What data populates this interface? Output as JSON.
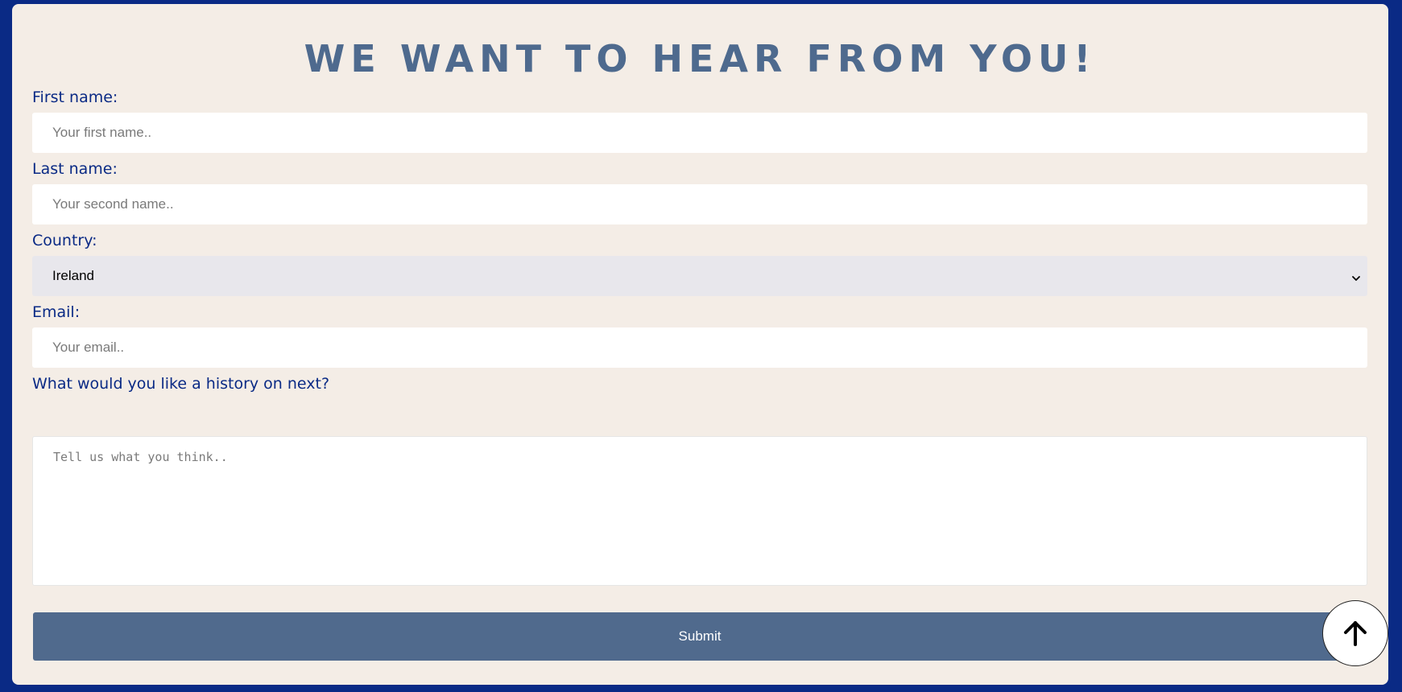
{
  "form": {
    "title": "WE WANT TO HEAR FROM YOU!",
    "first_name": {
      "label": "First name:",
      "placeholder": "Your first name..",
      "value": ""
    },
    "last_name": {
      "label": "Last name:",
      "placeholder": "Your second name..",
      "value": ""
    },
    "country": {
      "label": "Country:",
      "selected": "Ireland",
      "icon": "chevron-down-icon"
    },
    "email": {
      "label": "Email:",
      "placeholder": "Your email..",
      "value": ""
    },
    "message": {
      "label": "What would you like a history on next?",
      "placeholder": "Tell us what you think..",
      "value": ""
    },
    "submit_label": "Submit"
  },
  "back_to_top": {
    "icon": "arrow-up-icon"
  },
  "colors": {
    "page_background": "#0a2a85",
    "card_background": "#f4ede6",
    "title": "#4e6a8e",
    "label": "#0a2a85",
    "button": "#506a8d",
    "select_background": "#e8e7ec"
  }
}
